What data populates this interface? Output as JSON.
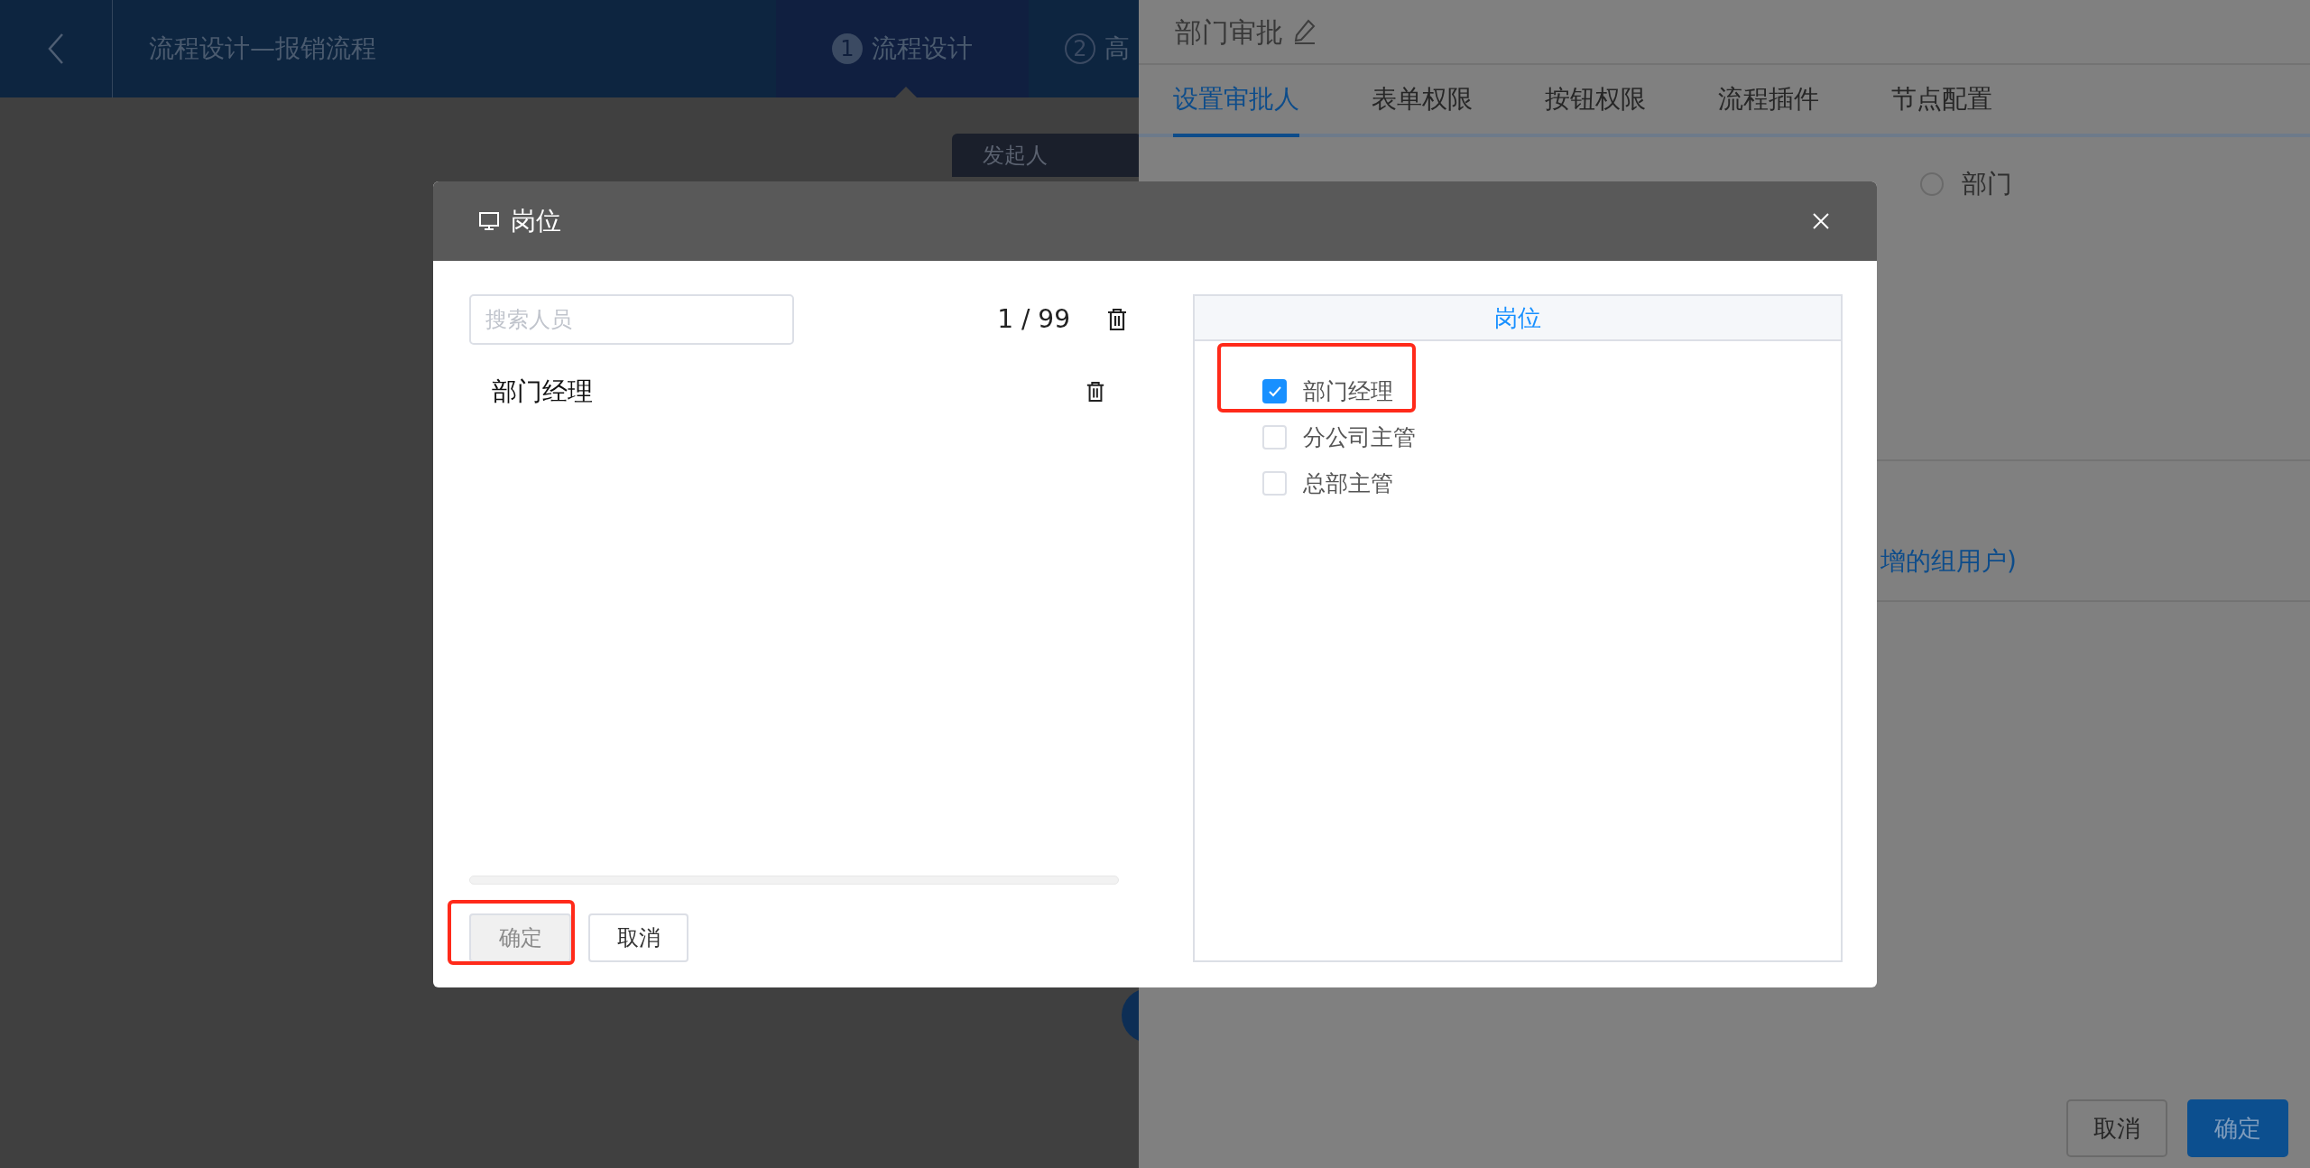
{
  "header": {
    "title": "流程设计—报销流程",
    "steps": [
      {
        "number": "1",
        "label": "流程设计",
        "selected": true
      },
      {
        "number": "2",
        "label": "高",
        "selected": false
      }
    ]
  },
  "canvas": {
    "start_node": "发起人"
  },
  "drawer": {
    "title": "部门审批",
    "tabs": [
      {
        "label": "设置审批人",
        "selected": true
      },
      {
        "label": "表单权限",
        "selected": false
      },
      {
        "label": "按钮权限",
        "selected": false
      },
      {
        "label": "流程插件",
        "selected": false
      },
      {
        "label": "节点配置",
        "selected": false
      }
    ],
    "approver_types": [
      {
        "label": "部门",
        "selected": false
      }
    ],
    "hint": "增的组用户)",
    "buttons": [
      {
        "label": "取消",
        "kind": "default"
      },
      {
        "label": "确定",
        "kind": "primary"
      }
    ]
  },
  "dialog": {
    "title": "岗位",
    "search": {
      "placeholder": "搜索人员"
    },
    "count": "1 / 99",
    "selected_items": [
      {
        "label": "部门经理"
      }
    ],
    "buttons": [
      {
        "label": "确定",
        "disabled": true,
        "highlighted": true
      },
      {
        "label": "取消",
        "disabled": false,
        "highlighted": false
      }
    ],
    "tree": {
      "heading": "岗位",
      "items": [
        {
          "label": "部门经理",
          "checked": true,
          "highlighted": true
        },
        {
          "label": "分公司主管",
          "checked": false,
          "highlighted": false
        },
        {
          "label": "总部主管",
          "checked": false,
          "highlighted": false
        }
      ]
    }
  }
}
